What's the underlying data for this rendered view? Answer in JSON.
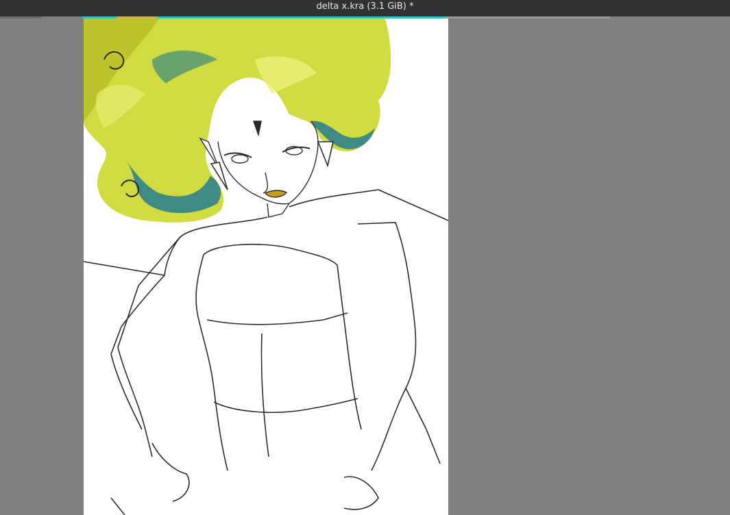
{
  "window": {
    "title": "delta x.kra (3.1 GiB) *"
  },
  "colors": {
    "titlebar_bg": "#323232",
    "titlebar_text": "#e8e8e8",
    "canvas_bg": "#808080",
    "document_bg": "#ffffff",
    "hair_light": "#d6e24a",
    "hair_mid": "#b8be2a",
    "hair_shadow": "#3f8a83",
    "lips": "#c7a017",
    "line": "#2a2a2a"
  },
  "canvas": {
    "content": "line-art illustration of a woman with flowing yellow-green hair"
  }
}
